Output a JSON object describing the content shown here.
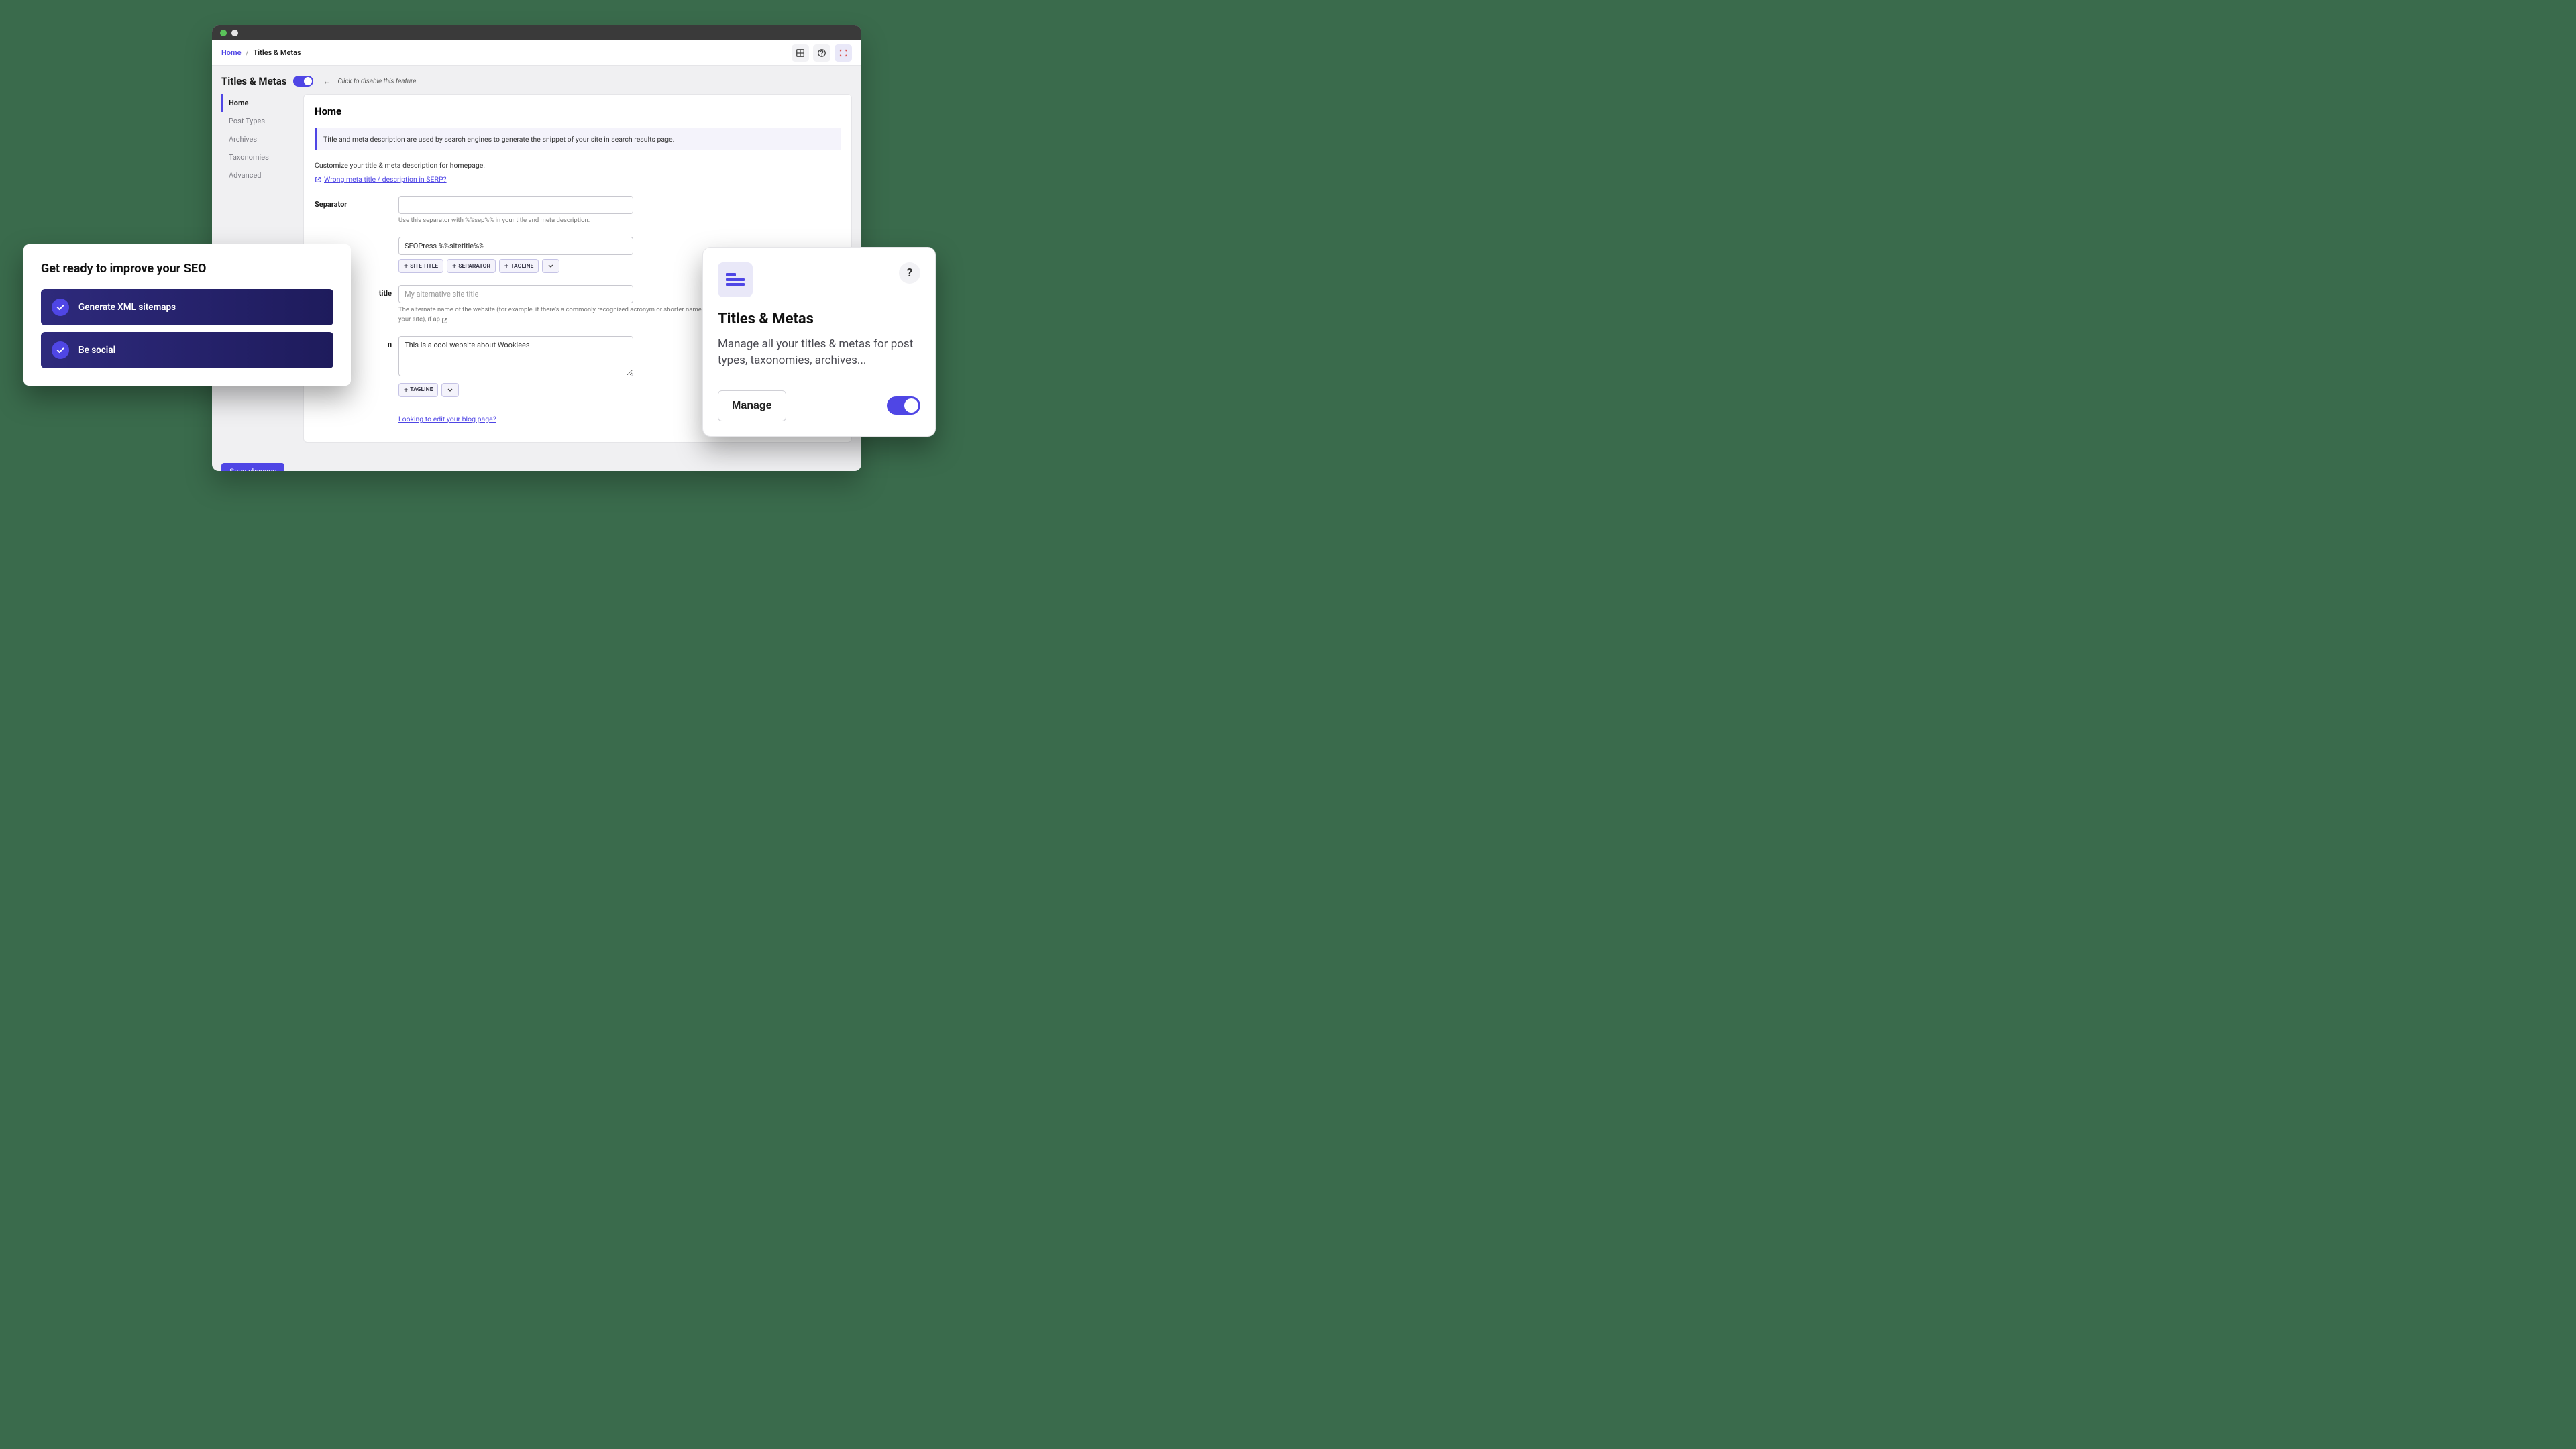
{
  "breadcrumb": {
    "home": "Home",
    "current": "Titles & Metas"
  },
  "page_title": "Titles & Metas",
  "disable_text": "Click to disable this feature",
  "sidebar": {
    "items": [
      {
        "label": "Home"
      },
      {
        "label": "Post Types"
      },
      {
        "label": "Archives"
      },
      {
        "label": "Taxonomies"
      },
      {
        "label": "Advanced"
      }
    ]
  },
  "main": {
    "heading": "Home",
    "info": "Title and meta description are used by search engines to generate the snippet of your site in search results page.",
    "customize": "Customize your title & meta description for homepage.",
    "serp_link": "Wrong meta title / description in SERP?",
    "separator": {
      "label": "Separator",
      "value": "-",
      "help": "Use this separator with %%sep%% in your title and meta description."
    },
    "site_title": {
      "value": "SEOPress %%sitetitle%%",
      "pills": {
        "site_title": "SITE TITLE",
        "separator": "SEPARATOR",
        "tagline": "TAGLINE"
      }
    },
    "alt_title": {
      "label": "title",
      "placeholder": "My alternative site title",
      "help": "The alternate name of the website (for example, if there's a commonly recognized acronym or shorter name for your site), if ap"
    },
    "meta_desc": {
      "label": "n",
      "value": "This is a cool website about Wookiees",
      "pill": "TAGLINE"
    },
    "blog_link": "Looking to edit your blog page?"
  },
  "save_button": "Save changes",
  "card1": {
    "heading": "Get ready to improve your SEO",
    "tasks": [
      {
        "label": "Generate XML sitemaps"
      },
      {
        "label": "Be social"
      }
    ]
  },
  "card2": {
    "help": "?",
    "heading": "Titles & Metas",
    "desc": "Manage all your titles & metas for post types, taxonomies, archives...",
    "manage": "Manage"
  }
}
